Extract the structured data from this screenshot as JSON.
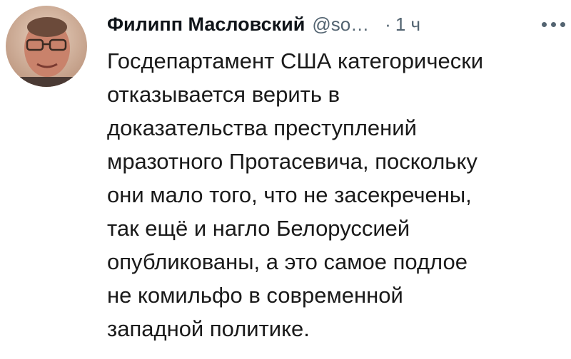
{
  "tweet": {
    "author_name": "Филипп Масловский",
    "handle": "@so…",
    "separator": "·",
    "time": "1 ч",
    "more_icon": "more-horizontal-icon",
    "text_lines": [
      "Госдепартамент США категорически",
      "отказывается верить в",
      "доказательства преступлений",
      "мразотного Протасевича, поскольку",
      "они мало того, что не засекречены,",
      "так ещё и нагло Белоруссией",
      "опубликованы, а это самое подлое",
      "не комильфо в современной",
      "западной политике."
    ]
  }
}
